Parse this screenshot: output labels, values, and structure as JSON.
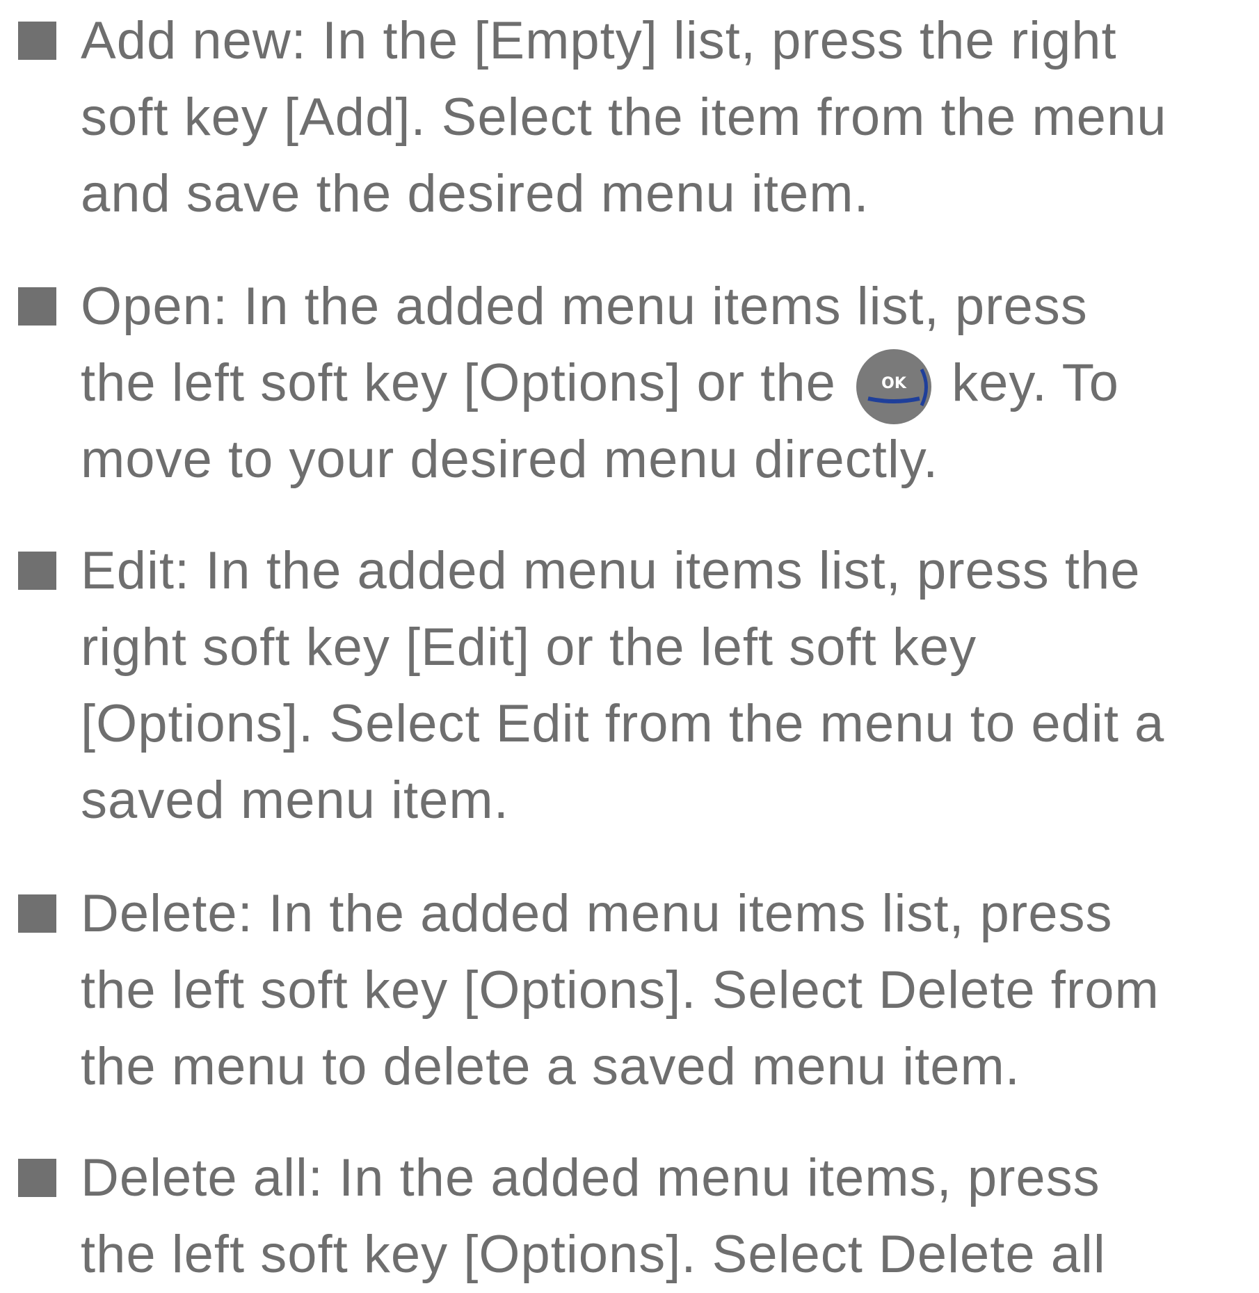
{
  "items": [
    {
      "lines": [
        "Add new: In the [Empty] list, press the right",
        "soft key [Add]. Select the item from the menu",
        "and save the desired menu item."
      ]
    },
    {
      "line1": "Open: In the added menu items list, press",
      "line2_before": "the left soft key [Options] or the",
      "ok_key_label": "OK",
      "line2_after": "key. To",
      "line3": "move to your desired menu directly."
    },
    {
      "lines": [
        "Edit: In the added menu items list, press the",
        "right soft key [Edit] or the left soft key",
        "[Options]. Select Edit from the menu to edit a",
        "saved menu item."
      ]
    },
    {
      "lines": [
        "Delete: In the added menu items list, press",
        "the left soft key [Options]. Select Delete from",
        "the menu to delete a saved menu item."
      ]
    },
    {
      "lines": [
        "Delete all: In the added menu items, press",
        "the left soft key [Options]. Select Delete all"
      ]
    }
  ],
  "colors": {
    "text": "#6e6e6e",
    "bullet": "#707070",
    "ok_key_fill": "#7a7a7a",
    "ok_key_accent": "#1f3f9a"
  },
  "icons": [
    "square-bullet-icon",
    "ok-key-icon"
  ]
}
